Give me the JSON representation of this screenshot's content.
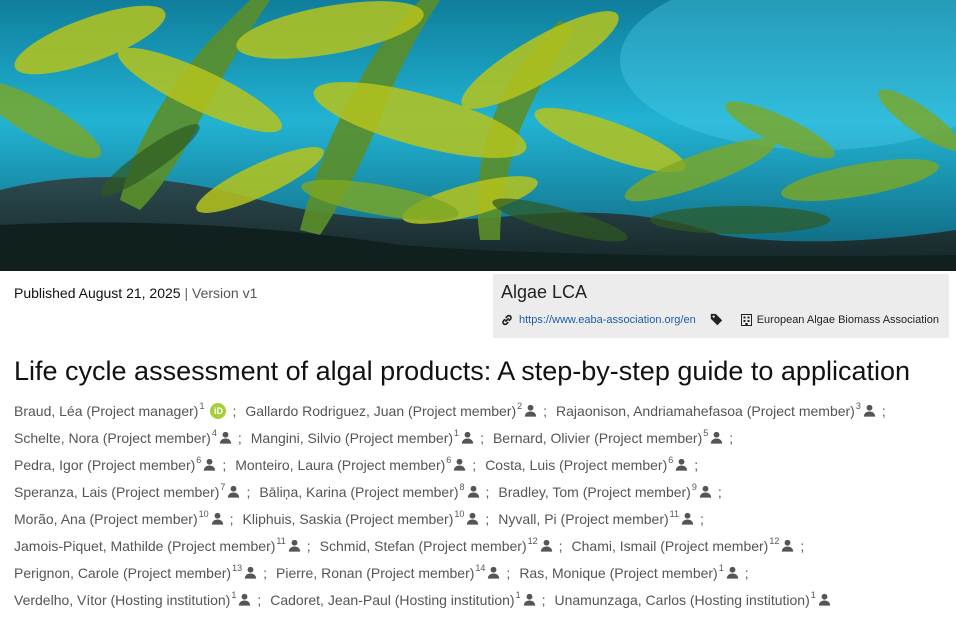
{
  "hero": {
    "image": "kelp-forest-underwater"
  },
  "publication": {
    "published": "Published August 21, 2025",
    "separator": "|",
    "version": "Version v1"
  },
  "community": {
    "name": "Algae LCA",
    "link_icon": "link-icon",
    "url": "https://www.eaba-association.org/en",
    "tag_icon": "tag-icon",
    "org_icon": "building-icon",
    "organization": "European Algae Biomass Association"
  },
  "title": "Life cycle assessment of algal products: A step-by-step guide to application",
  "creators_rows": [
    [
      {
        "name": "Braud, Léa (Project manager)",
        "aff": "1",
        "orcid": "iD"
      },
      {
        "name": "Gallardo Rodriguez, Juan (Project member)",
        "aff": "2"
      },
      {
        "name": "Rajaonison, Andriamahefasoa (Project member)",
        "aff": "3"
      }
    ],
    [
      {
        "name": "Schelte, Nora (Project member)",
        "aff": "4"
      },
      {
        "name": "Mangini, Silvio (Project member)",
        "aff": "1"
      },
      {
        "name": "Bernard, Olivier (Project member)",
        "aff": "5"
      }
    ],
    [
      {
        "name": "Pedra, Igor (Project member)",
        "aff": "6"
      },
      {
        "name": "Monteiro, Laura (Project member)",
        "aff": "6"
      },
      {
        "name": "Costa, Luis (Project member)",
        "aff": "6"
      }
    ],
    [
      {
        "name": "Speranza, Lais (Project member)",
        "aff": "7"
      },
      {
        "name": "Bāliņa, Karina (Project member)",
        "aff": "8"
      },
      {
        "name": "Bradley, Tom (Project member)",
        "aff": "9"
      }
    ],
    [
      {
        "name": "Morão, Ana (Project member)",
        "aff": "10"
      },
      {
        "name": "Kliphuis, Saskia (Project member)",
        "aff": "10"
      },
      {
        "name": "Nyvall, Pi (Project member)",
        "aff": "11"
      }
    ],
    [
      {
        "name": "Jamois-Piquet, Mathilde (Project member)",
        "aff": "11"
      },
      {
        "name": "Schmid, Stefan (Project member)",
        "aff": "12"
      },
      {
        "name": "Chami, Ismail (Project member)",
        "aff": "12"
      }
    ],
    [
      {
        "name": "Perignon, Carole (Project member)",
        "aff": "13"
      },
      {
        "name": "Pierre, Ronan (Project member)",
        "aff": "14"
      },
      {
        "name": "Ras, Monique (Project member)",
        "aff": "1"
      }
    ],
    [
      {
        "name": "Verdelho, Vítor (Hosting institution)",
        "aff": "1"
      },
      {
        "name": "Cadoret, Jean-Paul (Hosting institution)",
        "aff": "1"
      },
      {
        "name": "Unamunzaga, Carlos (Hosting institution)",
        "aff": "1"
      }
    ]
  ],
  "separator": ";",
  "user_icon": "user-icon",
  "colors": {
    "orcid": "#a6ce39",
    "link": "#1a5ea8",
    "community_bg": "#ececec"
  }
}
